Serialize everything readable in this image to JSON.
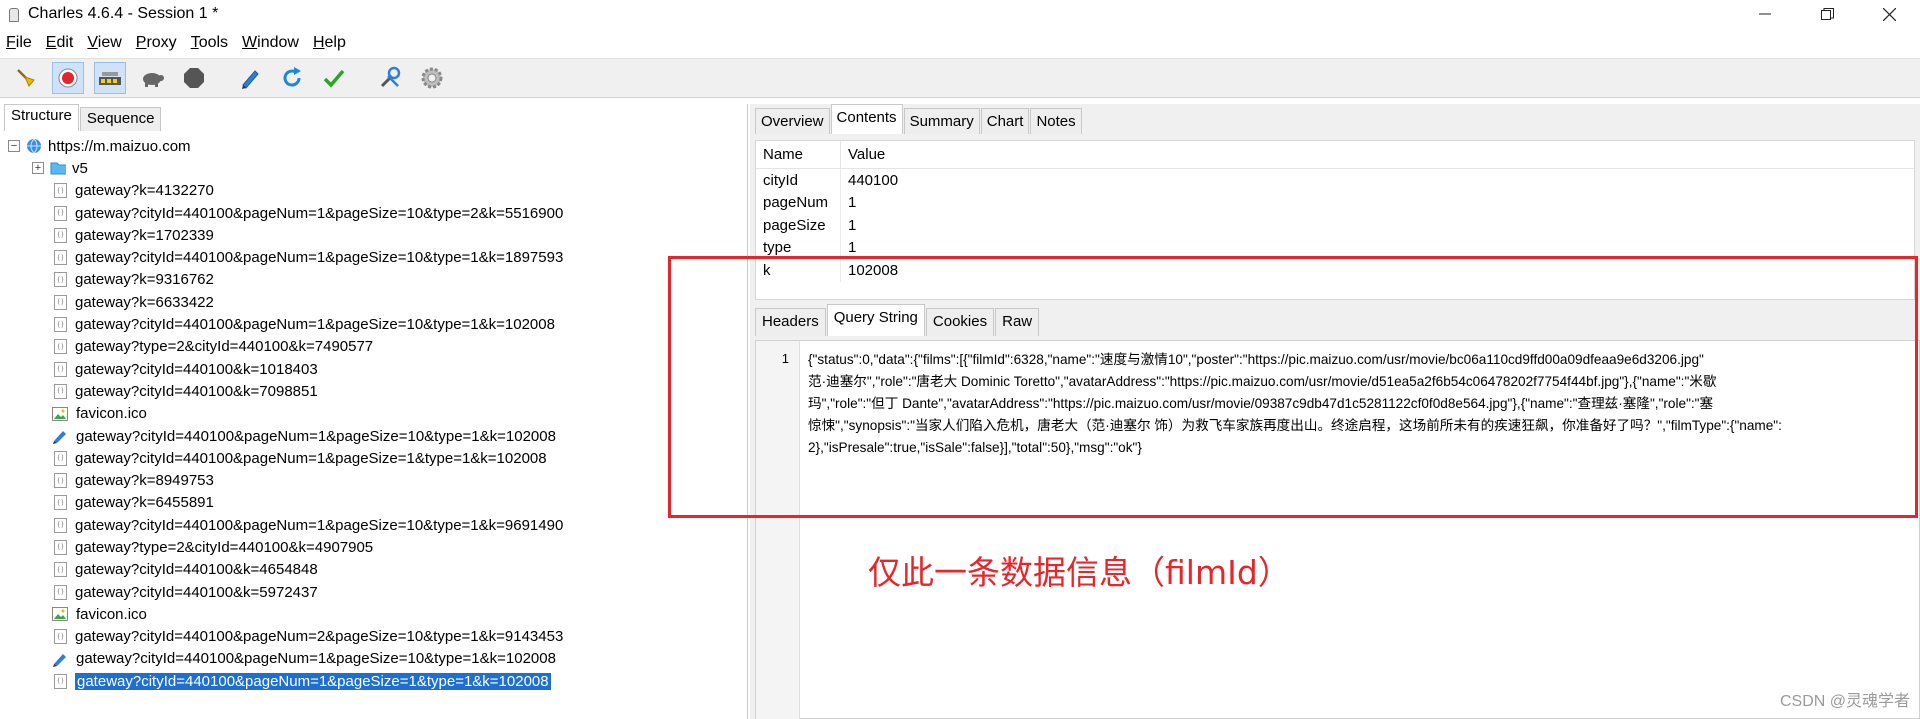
{
  "window": {
    "title": "Charles 4.6.4 - Session 1 *",
    "controls": {
      "minimize": "—",
      "maximize": "☐",
      "close": "✕"
    }
  },
  "menu": [
    {
      "label": "File"
    },
    {
      "label": "Edit"
    },
    {
      "label": "View"
    },
    {
      "label": "Proxy"
    },
    {
      "label": "Tools"
    },
    {
      "label": "Window"
    },
    {
      "label": "Help"
    }
  ],
  "toolbar": {
    "buttons": [
      "broom-icon",
      "record-icon",
      "throttle-icon",
      "turtle-icon",
      "stop-icon",
      "pen-icon",
      "refresh-icon",
      "check-icon",
      "tools-icon",
      "settings-icon"
    ]
  },
  "left": {
    "tabs": [
      "Structure",
      "Sequence"
    ],
    "host": "https://m.maizuo.com",
    "folder": "v5",
    "items": [
      {
        "type": "doc",
        "label": "gateway?k=4132270"
      },
      {
        "type": "doc",
        "label": "gateway?cityId=440100&pageNum=1&pageSize=10&type=2&k=5516900"
      },
      {
        "type": "doc",
        "label": "gateway?k=1702339"
      },
      {
        "type": "doc",
        "label": "gateway?cityId=440100&pageNum=1&pageSize=10&type=1&k=1897593"
      },
      {
        "type": "doc",
        "label": "gateway?k=9316762"
      },
      {
        "type": "doc",
        "label": "gateway?k=6633422"
      },
      {
        "type": "doc",
        "label": "gateway?cityId=440100&pageNum=1&pageSize=10&type=1&k=102008"
      },
      {
        "type": "doc",
        "label": "gateway?type=2&cityId=440100&k=7490577"
      },
      {
        "type": "doc",
        "label": "gateway?cityId=440100&k=1018403"
      },
      {
        "type": "doc",
        "label": "gateway?cityId=440100&k=7098851"
      },
      {
        "type": "img",
        "label": "favicon.ico"
      },
      {
        "type": "pen",
        "label": "gateway?cityId=440100&pageNum=1&pageSize=10&type=1&k=102008"
      },
      {
        "type": "doc",
        "label": "gateway?cityId=440100&pageNum=1&pageSize=1&type=1&k=102008"
      },
      {
        "type": "doc",
        "label": "gateway?k=8949753"
      },
      {
        "type": "doc",
        "label": "gateway?k=6455891"
      },
      {
        "type": "doc",
        "label": "gateway?cityId=440100&pageNum=1&pageSize=10&type=1&k=9691490"
      },
      {
        "type": "doc",
        "label": "gateway?type=2&cityId=440100&k=4907905"
      },
      {
        "type": "doc",
        "label": "gateway?cityId=440100&k=4654848"
      },
      {
        "type": "doc",
        "label": "gateway?cityId=440100&k=5972437"
      },
      {
        "type": "img",
        "label": "favicon.ico"
      },
      {
        "type": "doc",
        "label": "gateway?cityId=440100&pageNum=2&pageSize=10&type=1&k=9143453"
      },
      {
        "type": "pen",
        "label": "gateway?cityId=440100&pageNum=1&pageSize=10&type=1&k=102008"
      },
      {
        "type": "doc",
        "label": "gateway?cityId=440100&pageNum=1&pageSize=1&type=1&k=102008",
        "selected": true
      }
    ]
  },
  "right": {
    "tabs": [
      "Overview",
      "Contents",
      "Summary",
      "Chart",
      "Notes"
    ],
    "selected_tab": "Contents",
    "table": {
      "headers": [
        "Name",
        "Value"
      ],
      "rows": [
        {
          "name": "cityId",
          "value": "440100"
        },
        {
          "name": "pageNum",
          "value": "1"
        },
        {
          "name": "pageSize",
          "value": "1"
        },
        {
          "name": "type",
          "value": "1"
        },
        {
          "name": "k",
          "value": "102008"
        }
      ]
    },
    "subtabs": [
      "Headers",
      "Query String",
      "Cookies",
      "Raw"
    ],
    "selected_subtab": "Query String",
    "line_number": "1",
    "raw_lines": [
      "{\"status\":0,\"data\":{\"films\":[{\"filmId\":6328,\"name\":\"速度与激情10\",\"poster\":\"https://pic.maizuo.com/usr/movie/bc06a110cd9ffd00a09dfeaa9e6d3206.jpg\"",
      "范·迪塞尔\",\"role\":\"唐老大 Dominic Toretto\",\"avatarAddress\":\"https://pic.maizuo.com/usr/movie/d51ea5a2f6b54c06478202f7754f44bf.jpg\"},{\"name\":\"米歇",
      "玛\",\"role\":\"但丁 Dante\",\"avatarAddress\":\"https://pic.maizuo.com/usr/movie/09387c9db47d1c5281122cf0f0d8e564.jpg\"},{\"name\":\"查理兹·塞隆\",\"role\":\"塞",
      "惊悚\",\"synopsis\":\"当家人们陷入危机，唐老大（范·迪塞尔 饰）为救飞车家族再度出山。终途启程，这场前所未有的疾速狂飙，你准备好了吗？\",\"filmType\":{\"name\":",
      "2},\"isPresale\":true,\"isSale\":false}],\"total\":50},\"msg\":\"ok\"}"
    ]
  },
  "annotation": {
    "text": "仅此一条数据信息（filmId）",
    "color": "#e8262a"
  },
  "watermark": "CSDN @灵魂学者"
}
